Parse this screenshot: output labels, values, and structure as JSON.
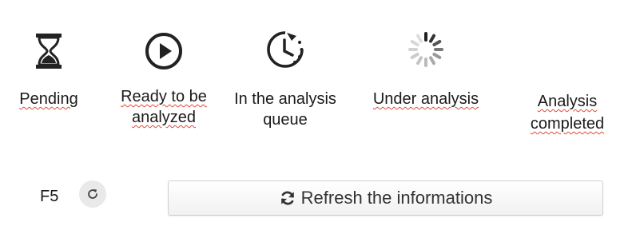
{
  "statuses": [
    {
      "label": "Pending",
      "icon": "hourglass-icon"
    },
    {
      "label": "Ready to be analyzed",
      "icon": "play-circle-icon"
    },
    {
      "label": "In the analysis queue",
      "icon": "clock-icon"
    },
    {
      "label": "Under analysis",
      "icon": "spinner-icon"
    },
    {
      "label": "Analysis completed",
      "icon": ""
    }
  ],
  "controls": {
    "shortcut_label": "F5",
    "refresh_button_label": "Refresh the informations"
  },
  "colors": {
    "text": "#1a1a1a",
    "spellcheck_underline": "#e0483b",
    "button_border": "#cfcfcf",
    "small_button_bg": "#e9e9e9"
  }
}
